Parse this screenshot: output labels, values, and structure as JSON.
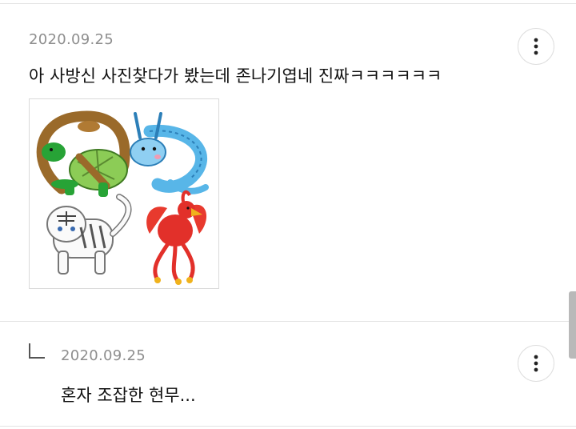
{
  "post": {
    "date": "2020.09.25",
    "text": "아 사방신 사진찾다가 봤는데 존나기엽네 진짜ㅋㅋㅋㅋㅋㅋ",
    "image": {
      "icons": [
        "turtle-snake-icon",
        "dragon-icon",
        "tiger-icon",
        "phoenix-icon"
      ]
    }
  },
  "reply": {
    "date": "2020.09.25",
    "text": "혼자 조잡한 현무..."
  },
  "icons": {
    "more": "more-vertical-icon",
    "reply": "reply-arrow-icon"
  },
  "colors": {
    "date": "#8e8e8e",
    "text": "#111111",
    "divider": "#e3e3e3"
  }
}
